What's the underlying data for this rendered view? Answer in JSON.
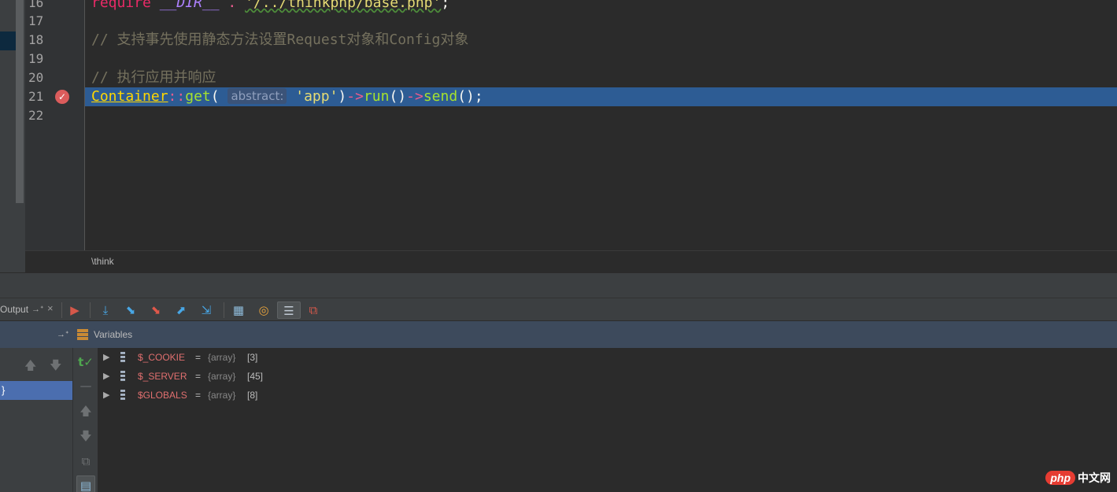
{
  "editor": {
    "line_numbers": [
      "16",
      "17",
      "18",
      "19",
      "20",
      "21",
      "22"
    ],
    "line16": {
      "keyword": "require",
      "dir": "__DIR__",
      "dot": " . ",
      "path": "'/../thinkphp/base.php'",
      "semi": ";"
    },
    "line18": {
      "comment": "// 支持事先使用静态方法设置Request对象和Config对象"
    },
    "line20": {
      "comment": "// 执行应用并响应"
    },
    "line21": {
      "class": "Container",
      "scope": "::",
      "method": "get",
      "open": "(",
      "param_hint": "abstract:",
      "arg": "'app'",
      "close": ")",
      "arrow1": "->",
      "run": "run",
      "parens1": "()",
      "arrow2": "->",
      "send": "send",
      "tail": "();"
    },
    "breadcrumb": "\\think"
  },
  "toolbar": {
    "panel_label": "Output",
    "pin_label": "→ᐩ",
    "close_label": "×"
  },
  "variables_panel": {
    "title": "Variables",
    "pin_label": "→ᐩ",
    "frame_selected": "}",
    "variables": [
      {
        "name": "$_COOKIE",
        "eq": "=",
        "type": "{array}",
        "count": "[3]"
      },
      {
        "name": "$_SERVER",
        "eq": "=",
        "type": "{array}",
        "count": "[45]"
      },
      {
        "name": "$GLOBALS",
        "eq": "=",
        "type": "{array}",
        "count": "[8]"
      }
    ]
  },
  "watermark": {
    "logo": "php",
    "text": "中文网"
  },
  "colors": {
    "highlight_line": "#2d5c94",
    "selection": "#4b6eaf",
    "breakpoint": "#db5c5c",
    "variable_name": "#e06f6f"
  },
  "icons": {
    "breakpoint": "breakpoint-check-icon",
    "toolbar": [
      "show-execution-point-icon",
      "step-over-icon",
      "step-into-icon",
      "force-step-into-icon",
      "step-out-icon",
      "run-to-cursor-icon",
      "evaluate-expression-icon",
      "watch-icon",
      "variables-view-icon",
      "restore-layout-icon"
    ]
  }
}
